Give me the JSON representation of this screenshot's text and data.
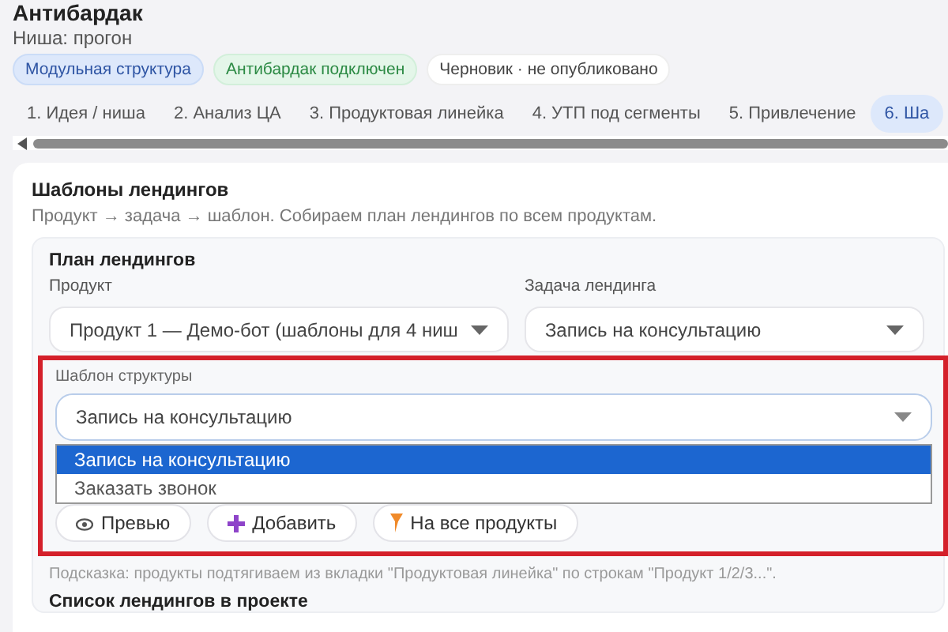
{
  "project": {
    "title": "Антибардак",
    "niche": "Ниша: прогон"
  },
  "badges": [
    {
      "label": "Модульная структура",
      "kind": "info"
    },
    {
      "label": "Антибардак подключен",
      "kind": "success"
    },
    {
      "label": "Черновик · не опубликовано",
      "kind": "neutral"
    }
  ],
  "tabs": [
    {
      "label": "1. Идея / ниша",
      "selected": false
    },
    {
      "label": "2. Анализ ЦА",
      "selected": false
    },
    {
      "label": "3. Продуктовая линейка",
      "selected": false
    },
    {
      "label": "4. УТП под сегменты",
      "selected": false
    },
    {
      "label": "5. Привлечение",
      "selected": false
    },
    {
      "label": "6. Ша",
      "selected": true
    }
  ],
  "section": {
    "title": "Шаблоны лендингов",
    "description": "Продукт → задача → шаблон. Собираем план лендингов по всем продуктам.",
    "plan": {
      "title": "План лендингов",
      "product": {
        "label": "Продукт",
        "value": "Продукт 1 — Демо-бот (шаблоны для 4 ниш"
      },
      "task": {
        "label": "Задача лендинга",
        "value": "Запись на консультацию"
      },
      "template": {
        "label": "Шаблон структуры",
        "value": "Запись на консультацию",
        "expanded": true,
        "options": [
          {
            "label": "Запись на консультацию",
            "selected": true
          },
          {
            "label": "Заказать звонок",
            "selected": false
          }
        ]
      },
      "actions": [
        {
          "label": "Превью",
          "kind": "preview"
        },
        {
          "label": "Добавить",
          "kind": "add"
        },
        {
          "label": "На все продукты",
          "kind": "all"
        }
      ],
      "hint": "Подсказка: продукты подтягиваем из вкладки \"Продуктовая линейка\" по строкам \"Продукт 1/2/3...\"."
    },
    "list_title": "Список лендингов в проекте"
  }
}
